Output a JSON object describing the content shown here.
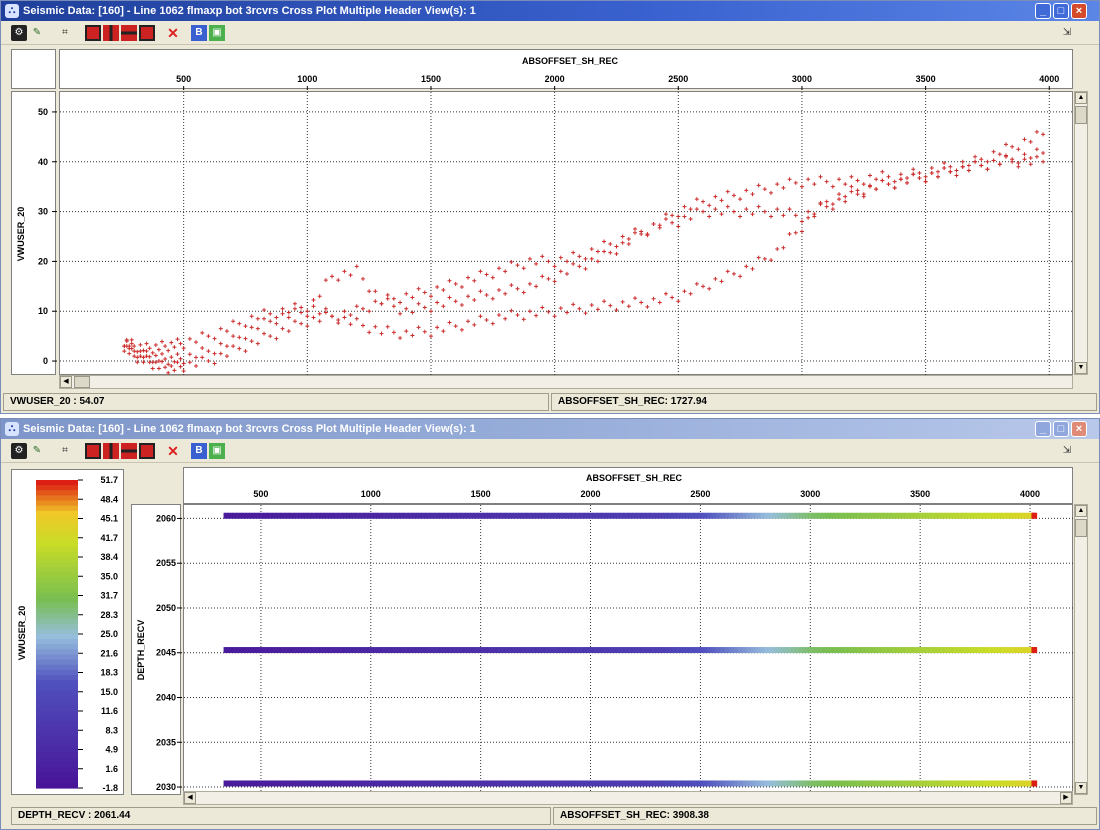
{
  "window1": {
    "title": "Seismic Data: [160] - Line 1062 flmaxp bot 3rcvrs Cross Plot Multiple Header View(s): 1",
    "status_left": "VWUSER_20 :    54.07",
    "status_right": "ABSOFFSET_SH_REC:   1727.94"
  },
  "window2": {
    "title": "Seismic Data: [160] - Line 1062 flmaxp bot 3rcvrs Cross Plot Multiple Header View(s): 1",
    "status_left": "DEPTH_RECV :    2061.44",
    "status_right": "ABSOFFSET_SH_REC:   3908.38"
  },
  "toolbar_icons": [
    "settings-icon",
    "pencil-icon",
    "chart-icon",
    "stop-icon",
    "column-icon",
    "row-icon",
    "grid-icon",
    "delete-icon",
    "b-icon",
    "export-icon"
  ],
  "colors": {
    "scatter": "#cc2b2b",
    "title_active": "#2b50b8",
    "title_inactive": "#8ea4d3"
  },
  "chart_data": [
    {
      "type": "scatter",
      "xlabel": "ABSOFFSET_SH_REC",
      "ylabel": "VWUSER_20",
      "xlim": [
        0,
        4100
      ],
      "ylim": [
        -3,
        54
      ],
      "x_ticks": [
        500,
        1000,
        1500,
        2000,
        2500,
        3000,
        3500,
        4000
      ],
      "y_ticks": [
        0,
        10,
        20,
        30,
        40,
        50
      ],
      "grid": true,
      "series": [
        {
          "x": [
            260,
            300,
            350,
            400,
            450,
            500,
            600,
            700,
            800,
            900,
            1000,
            1100,
            1200,
            1300,
            1400,
            1500,
            1600,
            1700,
            1800,
            1900,
            2000,
            2100,
            2200,
            2300,
            2400,
            2500,
            2600,
            2700,
            2800,
            2900,
            3000,
            3100,
            3200,
            3300,
            3400,
            3500,
            3600,
            3700,
            3800,
            3900,
            4000
          ],
          "y": [
            4,
            3,
            2.5,
            2.8,
            3.2,
            3.6,
            5,
            7,
            9,
            10,
            11,
            9,
            7.5,
            6,
            5.5,
            6,
            7,
            8,
            9,
            9.5,
            10,
            10.5,
            11,
            11.5,
            12,
            13,
            15,
            17,
            19,
            22,
            27,
            32,
            34,
            35,
            36,
            37,
            38,
            39,
            40,
            40,
            40
          ]
        },
        {
          "x": [
            260,
            300,
            350,
            400,
            450,
            500,
            600,
            700,
            800,
            900,
            1000,
            1100,
            1200,
            1300,
            1400,
            1500,
            1600,
            1700,
            1800,
            1900,
            2000,
            2100,
            2200,
            2300,
            2400,
            2500,
            2600,
            2700,
            2800,
            2900,
            3000,
            3100,
            3200,
            3300,
            3400,
            3500,
            3600,
            3700,
            3800,
            3900,
            4000
          ],
          "y": [
            4,
            2,
            1,
            0.5,
            0.3,
            0.5,
            2,
            4,
            7,
            9,
            10,
            17,
            18,
            12,
            10,
            11,
            12,
            13,
            14,
            15,
            17,
            19,
            21,
            24,
            27,
            30,
            32,
            33,
            34,
            35,
            36,
            36,
            36,
            37,
            37,
            38,
            39,
            40,
            42,
            44,
            46
          ]
        },
        {
          "x": [
            260,
            300,
            350,
            400,
            450,
            500,
            600,
            700,
            800,
            900,
            1000,
            1100,
            1200,
            1300,
            1400,
            1500,
            1600,
            1700,
            1800,
            1900,
            2000,
            2100,
            2200,
            2300,
            2400,
            2500,
            2600,
            2700,
            2800,
            2900,
            3000,
            3100,
            3200,
            3300,
            3400,
            3500,
            3600,
            3700,
            3800,
            3900,
            4000
          ],
          "y": [
            3,
            1,
            0,
            -1,
            -1.5,
            -1,
            0,
            2,
            4,
            6,
            8,
            9,
            10,
            12,
            13,
            14,
            15.5,
            17,
            18.5,
            20,
            20,
            21,
            23,
            25,
            27,
            28,
            30,
            30,
            30,
            30,
            29,
            31,
            33,
            35,
            36,
            37,
            38,
            39,
            40,
            41,
            42
          ]
        }
      ]
    },
    {
      "type": "scatter",
      "xlabel": "ABSOFFSET_SH_REC",
      "ylabel": "DEPTH_RECV",
      "color_label": "VWUSER_20",
      "xlim": [
        150,
        4200
      ],
      "ylim": [
        2029,
        2061.5
      ],
      "x_ticks": [
        500,
        1000,
        1500,
        2000,
        2500,
        3000,
        3500,
        4000
      ],
      "y_ticks": [
        2030,
        2035,
        2040,
        2045,
        2050,
        2055,
        2060
      ],
      "depth_levels": [
        2060.3,
        2045.3,
        2030.4
      ],
      "x_start": 330,
      "x_end": 4020,
      "grid": true,
      "colorbar_values": [
        "51.7",
        "48.4",
        "45.1",
        "41.7",
        "38.4",
        "35.0",
        "31.7",
        "28.3",
        "25.0",
        "21.6",
        "18.3",
        "15.0",
        "11.6",
        "8.3",
        "4.9",
        "1.6",
        "-1.8"
      ]
    }
  ]
}
